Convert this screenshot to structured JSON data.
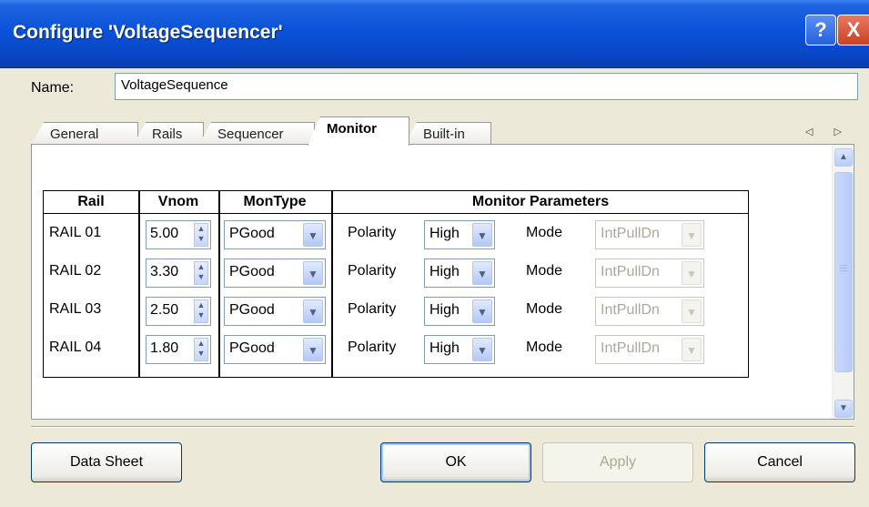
{
  "window": {
    "title": "Configure 'VoltageSequencer'",
    "help_glyph": "?",
    "close_glyph": "X"
  },
  "name_field": {
    "label": "Name:",
    "value": "VoltageSequence"
  },
  "tabs": [
    {
      "label": "General",
      "active": false
    },
    {
      "label": "Rails",
      "active": false
    },
    {
      "label": "Sequencer",
      "active": false
    },
    {
      "label": "Monitor",
      "active": true
    },
    {
      "label": "Built-in",
      "active": false
    }
  ],
  "tab_nav": "◁ ▷",
  "table": {
    "headers": [
      "Rail",
      "Vnom",
      "MonType",
      "Monitor Parameters"
    ],
    "polarity_label": "Polarity",
    "mode_label": "Mode",
    "rows": [
      {
        "rail": "RAIL 01",
        "vnom": "5.00",
        "montype": "PGood",
        "polarity": "High",
        "mode": "IntPullDn"
      },
      {
        "rail": "RAIL 02",
        "vnom": "3.30",
        "montype": "PGood",
        "polarity": "High",
        "mode": "IntPullDn"
      },
      {
        "rail": "RAIL 03",
        "vnom": "2.50",
        "montype": "PGood",
        "polarity": "High",
        "mode": "IntPullDn"
      },
      {
        "rail": "RAIL 04",
        "vnom": "1.80",
        "montype": "PGood",
        "polarity": "High",
        "mode": "IntPullDn"
      }
    ]
  },
  "buttons": {
    "datasheet": "Data Sheet",
    "ok": "OK",
    "apply": "Apply",
    "cancel": "Cancel"
  },
  "icons": {
    "scroll_up": "chevron-up-icon",
    "scroll_down": "chevron-down-icon",
    "spin": "spin-updown-icon",
    "dropdown": "chevron-down-icon"
  }
}
